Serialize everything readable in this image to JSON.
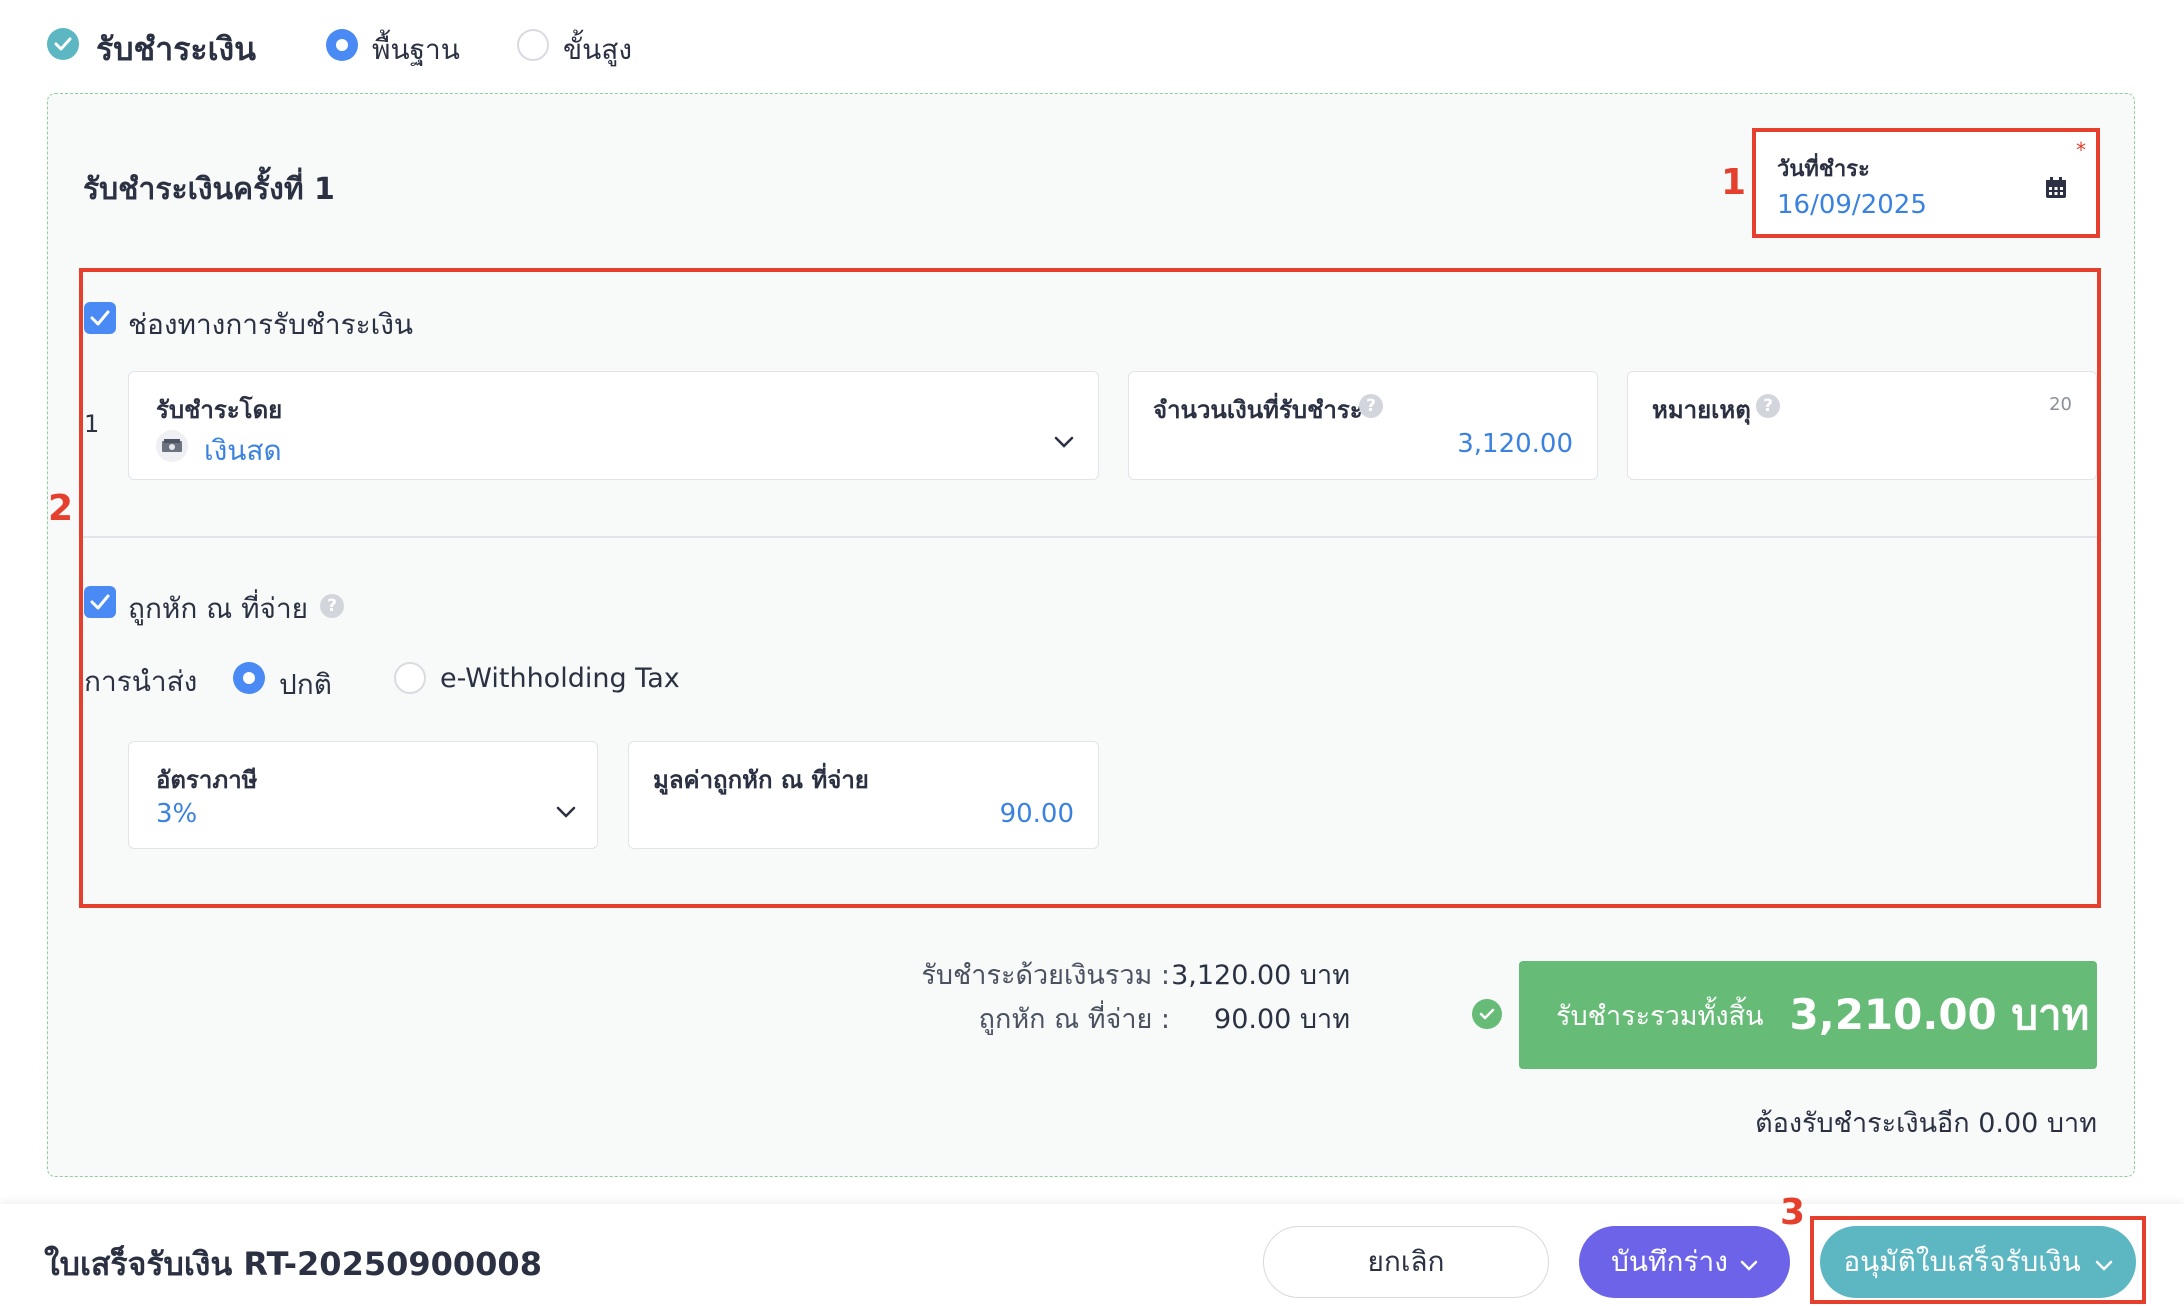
{
  "header": {
    "section_title": "รับชำระเงิน",
    "mode_basic": "พื้นฐาน",
    "mode_advanced": "ขั้นสูง"
  },
  "payment": {
    "round_title": "รับชำระเงินครั้งที่ 1",
    "date_label": "วันที่ชำระ",
    "date_required_mark": "*",
    "date_value": "16/09/2025"
  },
  "channel": {
    "checkbox_label": "ช่องทางการรับชำระเงิน",
    "row_number": "1",
    "method_label": "รับชำระโดย",
    "method_value": "เงินสด",
    "amount_label": "จำนวนเงินที่รับชำระ",
    "amount_value": "3,120.00",
    "note_label": "หมายเหตุ",
    "note_counter": "20"
  },
  "withholding": {
    "checkbox_label": "ถูกหัก ณ ที่จ่าย",
    "submit_label": "การนำส่ง",
    "option_normal": "ปกติ",
    "option_etax": "e-Withholding Tax",
    "rate_label": "อัตราภาษี",
    "rate_value": "3%",
    "value_label": "มูลค่าถูกหัก ณ ที่จ่าย",
    "value_amount": "90.00"
  },
  "summary": {
    "paid_label": "รับชำระด้วยเงินรวม :",
    "paid_value": "3,120.00 บาท",
    "withheld_label": "ถูกหัก ณ ที่จ่าย :",
    "withheld_value": "90.00 บาท",
    "total_label": "รับชำระรวมทั้งสิ้น",
    "total_value": "3,210.00 บาท",
    "remaining": "ต้องรับชำระเงินอีก 0.00 บาท"
  },
  "footer": {
    "doc_title": "ใบเสร็จรับเงิน RT-20250900008",
    "cancel": "ยกเลิก",
    "save_draft": "บันทึกร่าง",
    "approve": "อนุมัติใบเสร็จรับเงิน"
  },
  "annotations": [
    "1",
    "2",
    "3"
  ],
  "colors": {
    "accent_blue": "#4a8af4",
    "total_green": "#66bb77",
    "draft_purple": "#6c63e8",
    "approve_teal": "#5cb7c2",
    "annotation_red": "#e53f2d"
  }
}
